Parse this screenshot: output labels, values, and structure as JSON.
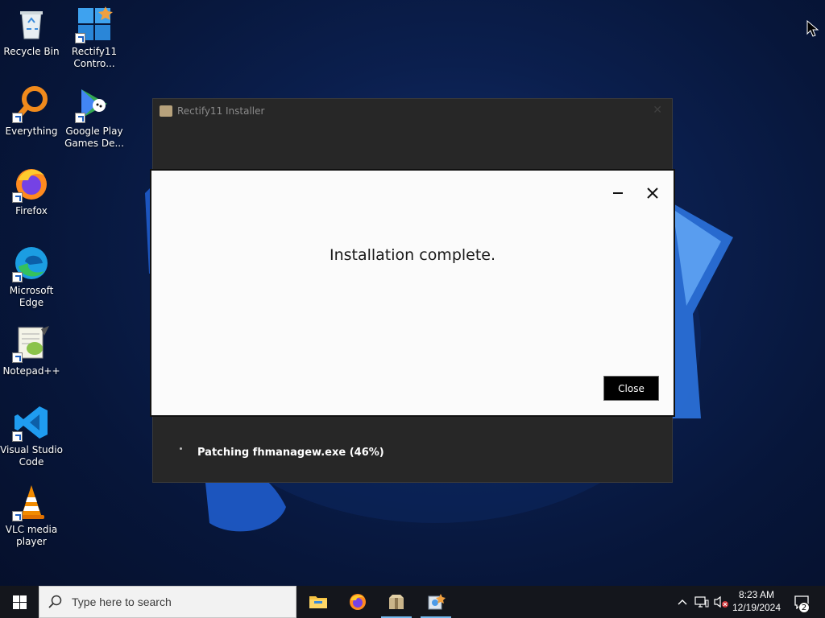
{
  "desktop": {
    "icons": [
      {
        "label": "Recycle Bin"
      },
      {
        "label": "Rectify11\nContro..."
      },
      {
        "label": "Everything"
      },
      {
        "label": "Google Play\nGames De..."
      },
      {
        "label": "Firefox"
      },
      {
        "label": "Microsoft\nEdge"
      },
      {
        "label": "Notepad++"
      },
      {
        "label": "Visual Studio\nCode"
      },
      {
        "label": "VLC media\nplayer"
      }
    ]
  },
  "installer": {
    "title": "Rectify11 Installer",
    "close_glyph": "✕",
    "status_text": "Patching fhmanagew.exe (46%)",
    "patch_progress_percent": 46
  },
  "modal": {
    "message": "Installation complete.",
    "close_button_label": "Close"
  },
  "taskbar": {
    "search_placeholder": "Type here to search",
    "apps": [
      "file-explorer-icon",
      "firefox-icon",
      "installer-icon",
      "control-center-icon"
    ],
    "clock_time": "8:23 AM",
    "clock_date": "12/19/2024",
    "notification_count": "2"
  },
  "colors": {
    "taskbar_bg": "#14161c",
    "installer_bg": "#272727",
    "modal_bg": "#fbfbfb",
    "accent": "#76b9ed"
  }
}
